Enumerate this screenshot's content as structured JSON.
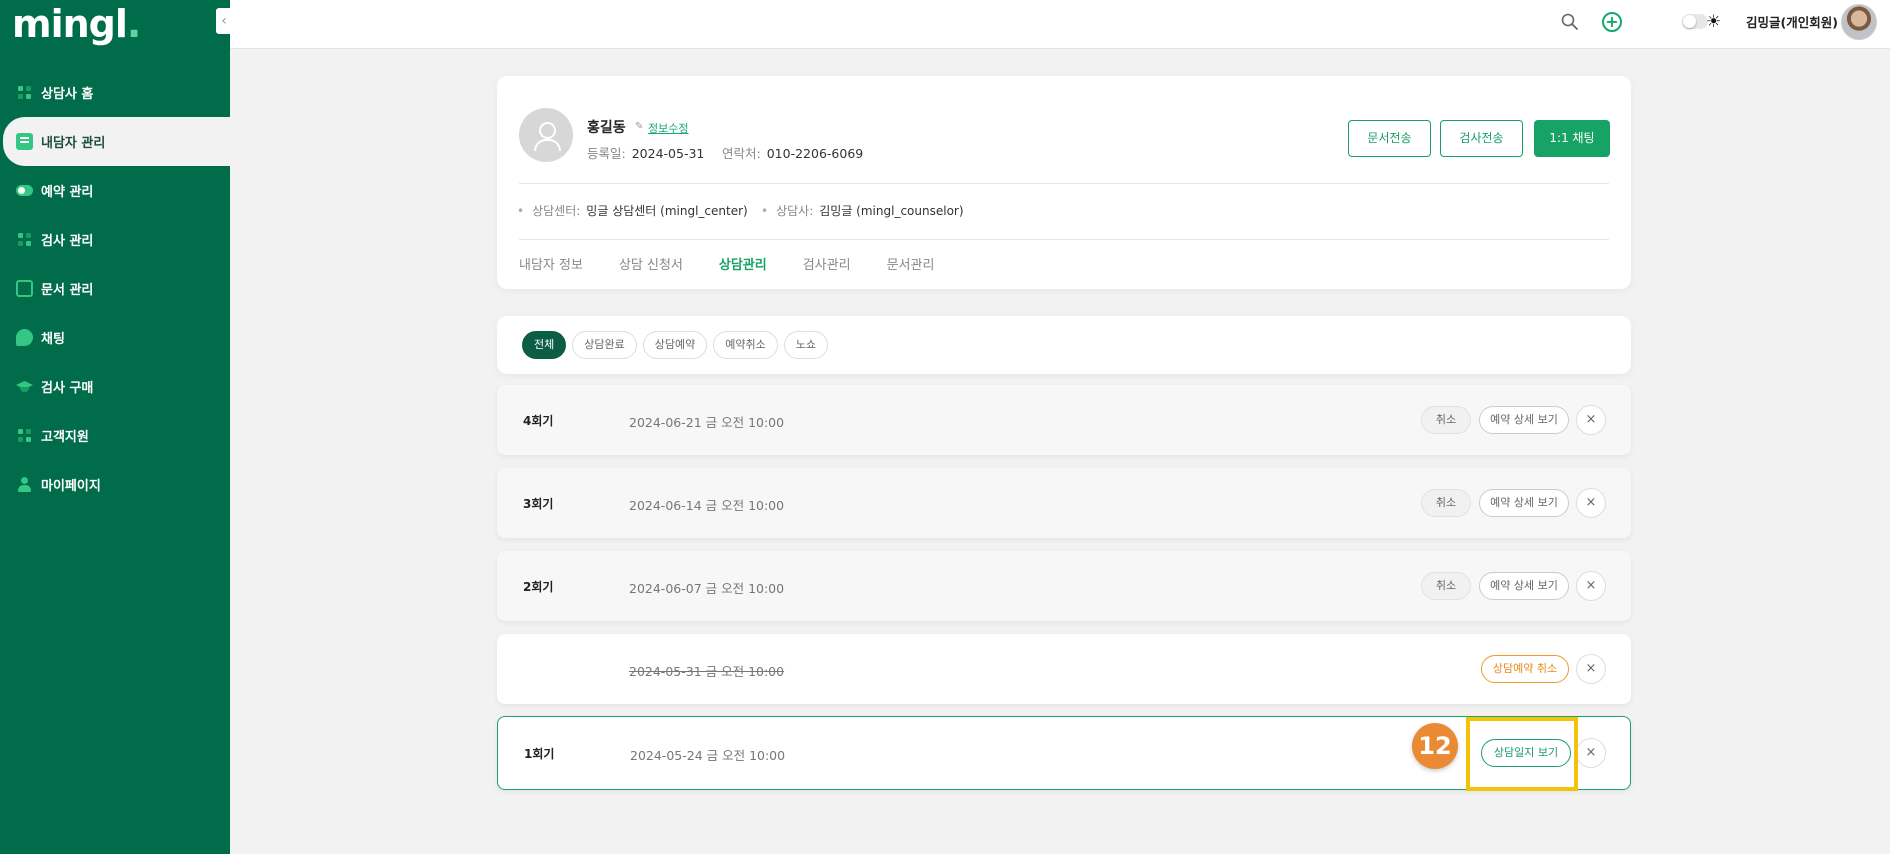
{
  "app": {
    "logo": "mingl",
    "logo_dot": "."
  },
  "sidebar": {
    "items": [
      {
        "label": "상담사 홈",
        "icon": "grid-icon"
      },
      {
        "label": "내담자 관리",
        "icon": "id-card-icon"
      },
      {
        "label": "예약 관리",
        "icon": "toggle-icon"
      },
      {
        "label": "검사 관리",
        "icon": "grid-icon"
      },
      {
        "label": "문서 관리",
        "icon": "document-icon"
      },
      {
        "label": "채팅",
        "icon": "chat-icon"
      },
      {
        "label": "검사 구매",
        "icon": "graduation-cap-icon"
      },
      {
        "label": "고객지원",
        "icon": "grid-icon"
      },
      {
        "label": "마이페이지",
        "icon": "person-icon"
      }
    ],
    "active_index": 1
  },
  "topbar": {
    "user_name": "김밍글(개인회원)",
    "theme_icon": "☀"
  },
  "profile": {
    "name": "홍길동",
    "edit_label": "정보수정",
    "registered_label": "등록일:",
    "registered_value": "2024-05-31",
    "contact_label": "연락처:",
    "contact_value": "010-2206-6069",
    "center_label": "상담센터:",
    "center_value": "밍글 상담센터 (mingl_center)",
    "counselor_label": "상담사:",
    "counselor_value": "김밍글 (mingl_counselor)",
    "buttons": {
      "send_doc": "문서전송",
      "send_test": "검사전송",
      "chat": "1:1 채팅"
    },
    "tabs": [
      "내담자 정보",
      "상담 신청서",
      "상담관리",
      "검사관리",
      "문서관리"
    ],
    "active_tab": 2
  },
  "filters": {
    "chips": [
      "전체",
      "상담완료",
      "상담예약",
      "예약취소",
      "노쇼"
    ],
    "active_index": 0
  },
  "sessions": [
    {
      "round": "4회기",
      "date": "2024-06-21 금 오전 10:00",
      "cancel": "취소",
      "detail": "예약 상세 보기",
      "close": "×"
    },
    {
      "round": "3회기",
      "date": "2024-06-14 금 오전 10:00",
      "cancel": "취소",
      "detail": "예약 상세 보기",
      "close": "×"
    },
    {
      "round": "2회기",
      "date": "2024-06-07 금 오전 10:00",
      "cancel": "취소",
      "detail": "예약 상세 보기",
      "close": "×"
    },
    {
      "round": "",
      "date": "2024-05-31 금 오전 10:00",
      "status": "상담예약 취소",
      "close": "×"
    },
    {
      "round": "1회기",
      "date": "2024-05-24 금 오전 10:00",
      "action": "상담일지 보기",
      "close": "×"
    }
  ],
  "annotation": {
    "step": "12",
    "highlight_color": "#f3c20a",
    "badge_color": "#ea8a34"
  },
  "colors": {
    "sidebar": "#006c4a",
    "accent": "#17a365",
    "warning": "#e88b17"
  }
}
